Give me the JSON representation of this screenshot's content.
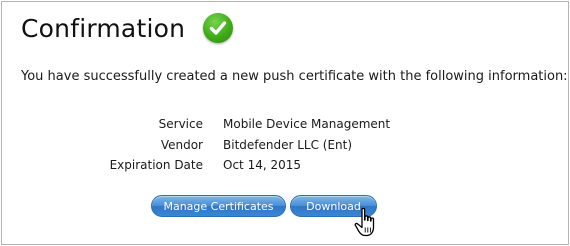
{
  "page": {
    "title": "Confirmation",
    "message": "You have successfully created a new push certificate with the following information:"
  },
  "details": [
    {
      "label": "Service",
      "value": "Mobile Device Management"
    },
    {
      "label": "Vendor",
      "value": "Bitdefender LLC (Ent)"
    },
    {
      "label": "Expiration Date",
      "value": "Oct 14, 2015"
    }
  ],
  "buttons": {
    "manage_label": "Manage Certificates",
    "download_label": "Download"
  },
  "icons": {
    "status": "checkmark-icon",
    "pointer": "hand-cursor-icon"
  },
  "colors": {
    "success_green": "#3fab19",
    "button_blue": "#3a86d6"
  }
}
